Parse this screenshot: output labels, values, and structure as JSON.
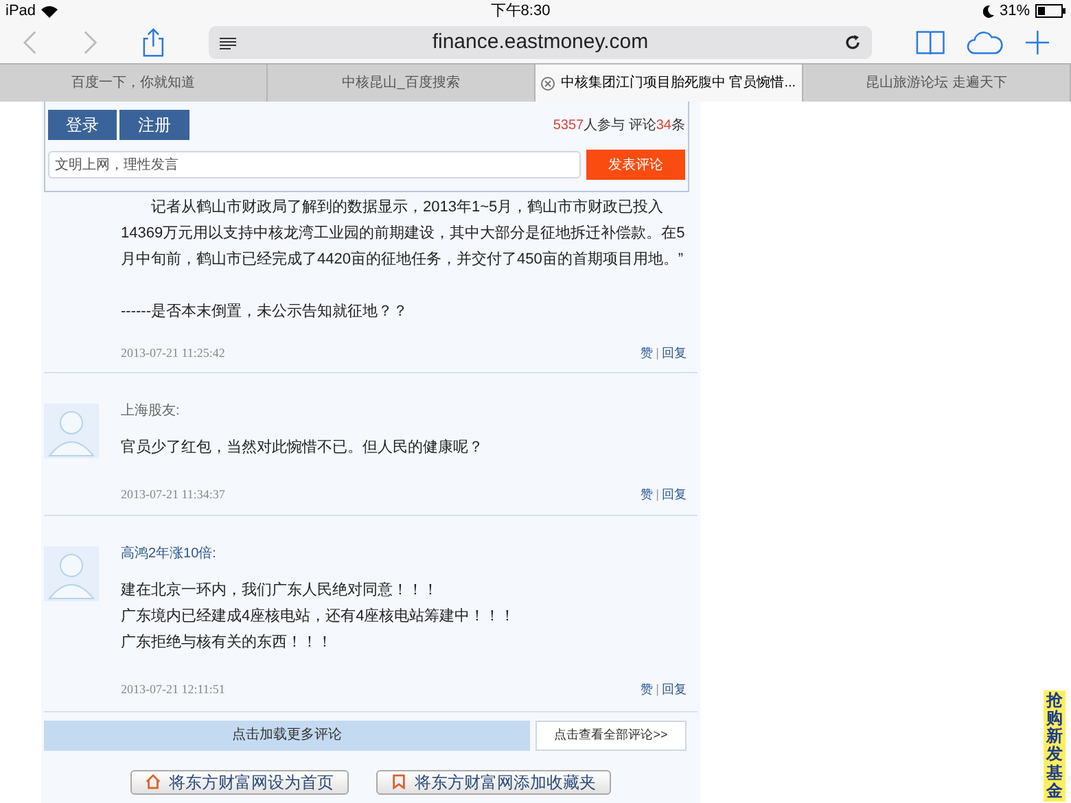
{
  "status_bar": {
    "device": "iPad",
    "time": "下午8:30",
    "battery": "31%"
  },
  "toolbar": {
    "url": "finance.eastmoney.com"
  },
  "tabs": [
    {
      "label": "百度一下，你就知道",
      "selected": false
    },
    {
      "label": "中核昆山_百度搜索",
      "selected": false
    },
    {
      "label": "中核集团江门项目胎死腹中 官员惋惜...",
      "selected": true
    },
    {
      "label": "昆山旅游论坛 走遍天下",
      "selected": false
    }
  ],
  "comment_box": {
    "login": "登录",
    "register": "注册",
    "participants": "5357",
    "participants_label": "人参与 评论",
    "comment_count": "34",
    "count_suffix": "条",
    "placeholder": "文明上网，理性发言",
    "submit": "发表评论"
  },
  "comments": [
    {
      "kind": "continuation",
      "paragraphs": [
        "记者从鹤山市财政局了解到的数据显示，2013年1~5月，鹤山市市财政已投入14369万元用以支持中核龙湾工业园的前期建设，其中大部分是征地拆迁补偿款。在5月中旬前，鹤山市已经完成了4420亩的征地任务，并交付了450亩的首期项目用地。”",
        "------是否本末倒置，未公示告知就征地？？"
      ],
      "time": "2013-07-21 11:25:42",
      "like": "赞",
      "separator": "|",
      "reply": "回复"
    },
    {
      "kind": "user",
      "author": "上海股友:",
      "paragraphs": [
        "官员少了红包，当然对此惋惜不已。但人民的健康呢？"
      ],
      "time": "2013-07-21 11:34:37",
      "like": "赞",
      "separator": "|",
      "reply": "回复"
    },
    {
      "kind": "user",
      "author": "高鸿2年涨10倍:",
      "paragraphs": [
        "建在北京一环内，我们广东人民绝对同意！！！",
        "广东境内已经建成4座核电站，还有4座核电站筹建中！！！",
        "广东拒绝与核有关的东西！！！"
      ],
      "time": "2013-07-21 12:11:51",
      "like": "赞",
      "separator": "|",
      "reply": "回复"
    }
  ],
  "load_more": "点击加载更多评论",
  "view_all": "点击查看全部评论>>",
  "footer_buttons": [
    {
      "kind": "home",
      "label": "将东方财富网设为首页"
    },
    {
      "kind": "bookmark",
      "label": "将东方财富网添加收藏夹"
    }
  ],
  "side_ad": "抢购新发基金"
}
